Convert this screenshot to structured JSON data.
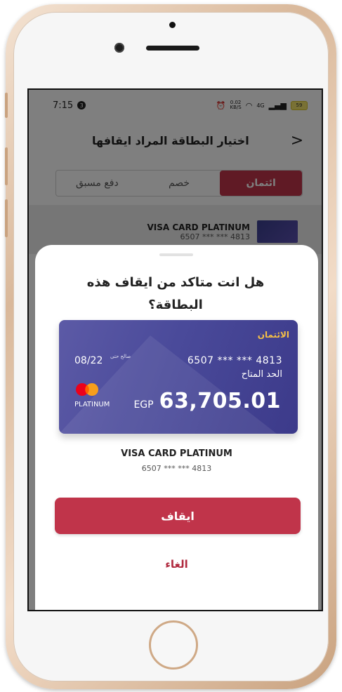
{
  "status_bar": {
    "time": "7:15",
    "notif_count": "3",
    "net_speed": "0.02",
    "net_unit": "KB/S",
    "signal": "4G",
    "battery": "59"
  },
  "header": {
    "title": "اختيار البطاقة المراد ايقافها",
    "back_icon": "chevron-right-icon"
  },
  "tabs": [
    {
      "label": "ائتمان",
      "active": true
    },
    {
      "label": "خصم",
      "active": false
    },
    {
      "label": "دفع مسبق",
      "active": false
    }
  ],
  "list": {
    "item_title": "VISA CARD PLATINUM",
    "item_number": "6507 *** *** 4813"
  },
  "sheet": {
    "title": "هل انت متاكد من ايقاف هذه البطاقة؟",
    "card": {
      "type": "الائتمان",
      "number": "6507 *** *** 4813",
      "available_label": "الحد المتاح",
      "valid_label": "صالح حتى",
      "expiry": "08/22",
      "tier": "PLATINUM",
      "currency": "EGP",
      "balance": "63,705.01",
      "brand_icon": "mastercard-icon"
    },
    "card_name": "VISA CARD PLATINUM",
    "card_masked": "6507 *** *** 4813",
    "stop_label": "ايقاف",
    "cancel_label": "الغاء"
  },
  "colors": {
    "accent": "#c0344a",
    "card_gold": "#f6c045",
    "card_bg": "#4a4a9a"
  }
}
